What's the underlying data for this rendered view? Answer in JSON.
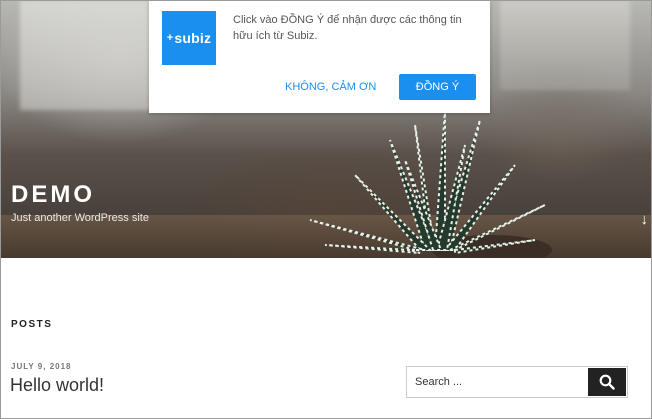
{
  "header": {
    "site_title": "DEMO",
    "site_description": "Just another WordPress site",
    "scroll_arrow": "↓"
  },
  "popup": {
    "logo_text": "subiz",
    "logo_plus": "+",
    "message": "Click vào ĐỒNG Ý để nhận được các thông tin hữu ích từ Subiz.",
    "decline_label": "KHÔNG, CẢM ƠN",
    "accept_label": "ĐỒNG Ý",
    "accent_color": "#1a8ff0"
  },
  "main": {
    "posts_heading": "POSTS",
    "post": {
      "date": "JULY 9, 2018",
      "title": "Hello world!"
    }
  },
  "sidebar": {
    "search_placeholder": "Search ..."
  }
}
